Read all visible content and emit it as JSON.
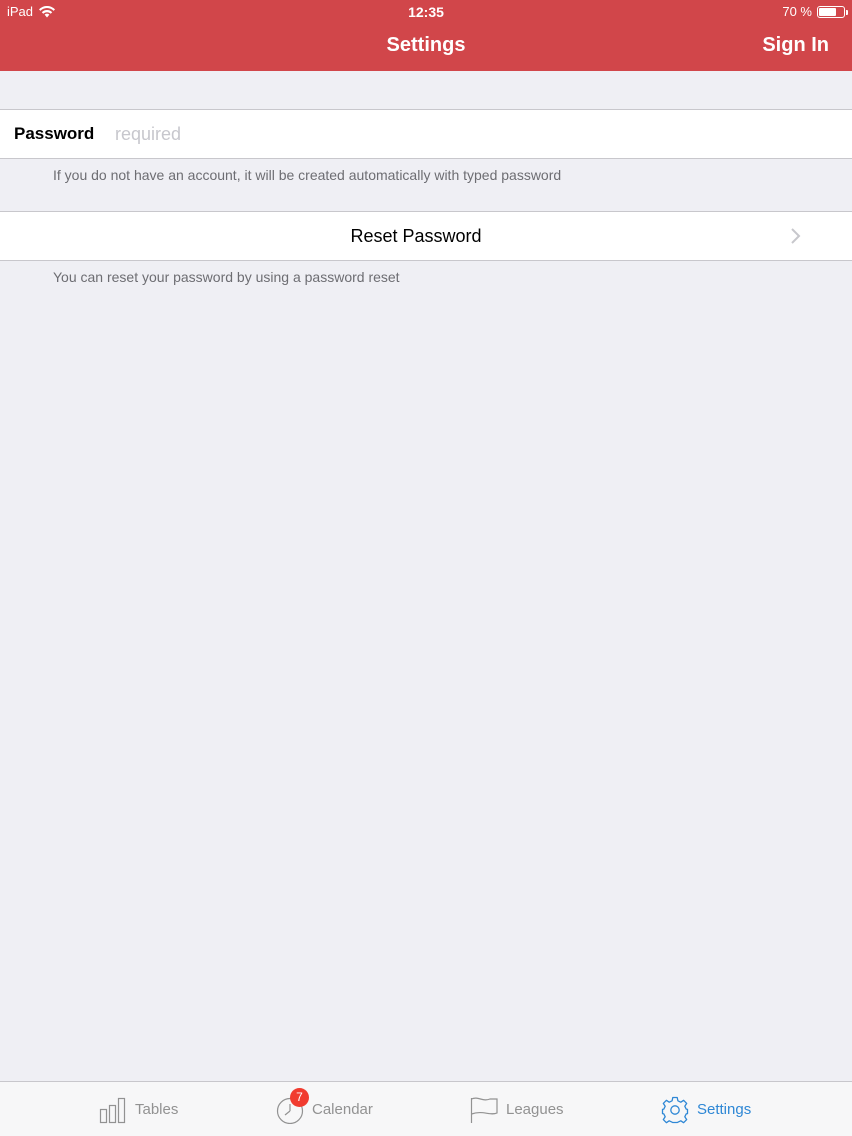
{
  "status_bar": {
    "carrier": "iPad",
    "time": "12:35",
    "battery_text": "70 %",
    "battery_level": 0.7
  },
  "nav": {
    "title": "Settings",
    "right_button": "Sign In"
  },
  "password_row": {
    "label": "Password",
    "value": "",
    "placeholder": "required"
  },
  "password_footnote": "If you do not have an account, it will be created automatically with typed password",
  "reset_row": {
    "label": "Reset Password"
  },
  "reset_footnote": "You can reset your password by using a password reset",
  "tabs": [
    {
      "label": "Tables",
      "icon": "bar-chart-icon",
      "active": false
    },
    {
      "label": "Calendar",
      "icon": "clock-icon",
      "badge": "7",
      "active": false
    },
    {
      "label": "Leagues",
      "icon": "flag-icon",
      "active": false
    },
    {
      "label": "Settings",
      "icon": "gear-icon",
      "active": true
    }
  ],
  "colors": {
    "header": "#d1464a",
    "accent": "#2e87d5",
    "background": "#efeff4",
    "badge": "#f13b2f"
  }
}
